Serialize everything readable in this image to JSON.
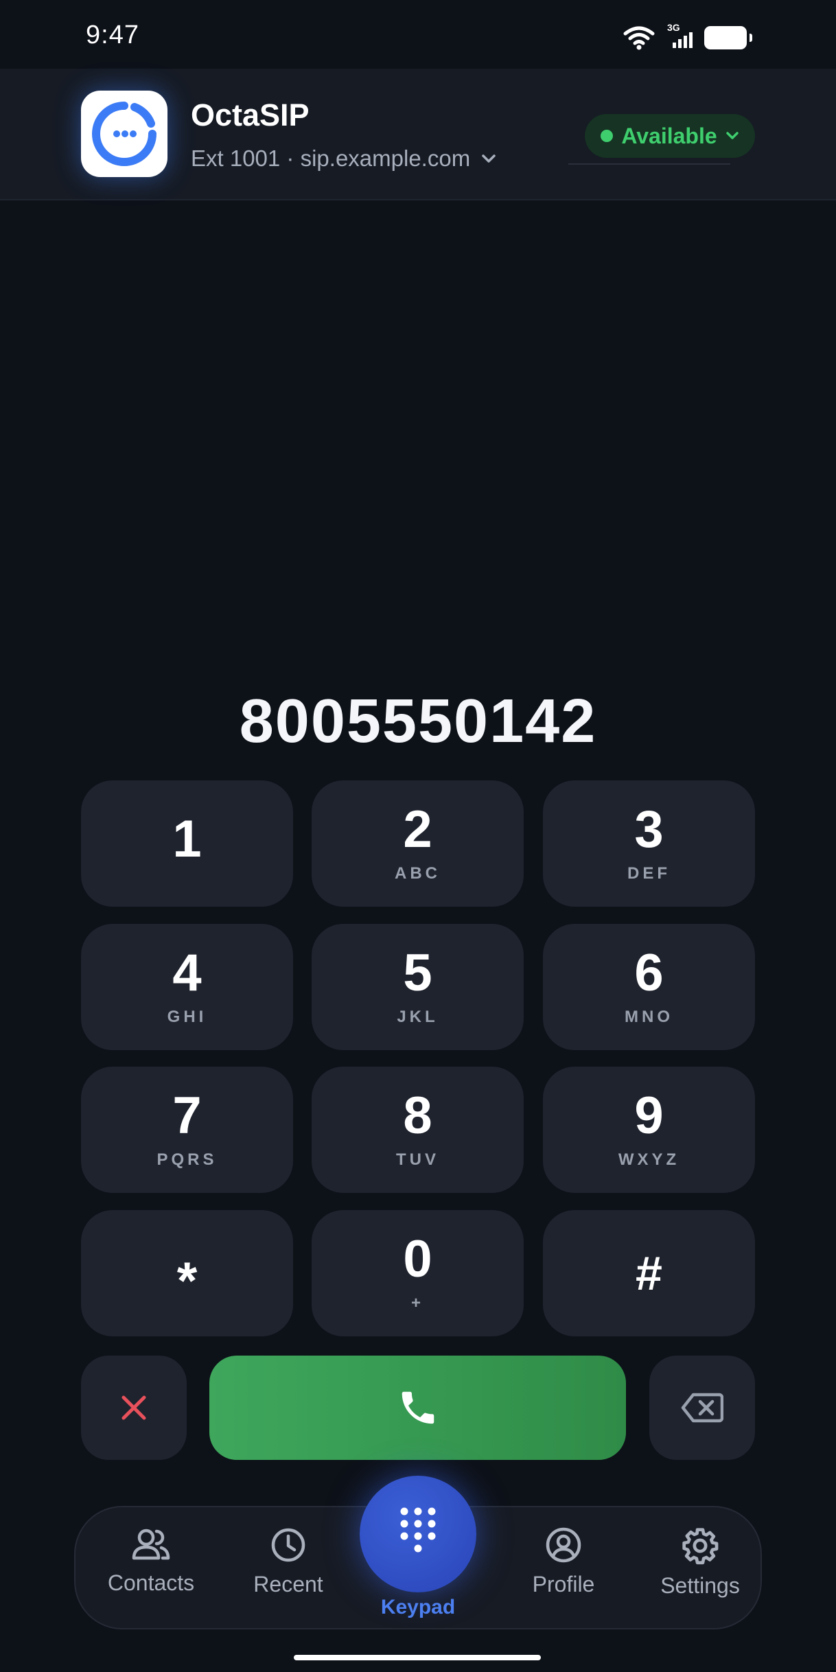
{
  "status_bar": {
    "time": "9:47",
    "network": "3G"
  },
  "header": {
    "app_name": "OctaSIP",
    "account": "Ext 1001 · sip.example.com",
    "presence": "Available",
    "presence_color": "#3fce6e",
    "logo_icon": "chat-bubble-logo-icon"
  },
  "dialer": {
    "number": "8005550142"
  },
  "keypad": {
    "keys": [
      {
        "digit": "1",
        "letters": ""
      },
      {
        "digit": "2",
        "letters": "ABC"
      },
      {
        "digit": "3",
        "letters": "DEF"
      },
      {
        "digit": "4",
        "letters": "GHI"
      },
      {
        "digit": "5",
        "letters": "JKL"
      },
      {
        "digit": "6",
        "letters": "MNO"
      },
      {
        "digit": "7",
        "letters": "PQRS"
      },
      {
        "digit": "8",
        "letters": "TUV"
      },
      {
        "digit": "9",
        "letters": "WXYZ"
      },
      {
        "digit": "*",
        "letters": ""
      },
      {
        "digit": "0",
        "letters": "+"
      },
      {
        "digit": "#",
        "letters": ""
      }
    ]
  },
  "actions": {
    "clear_icon": "close-icon",
    "call_icon": "phone-icon",
    "backspace_icon": "backspace-icon",
    "call_color": "#3ea75c",
    "clear_color": "#e8515b"
  },
  "nav": {
    "contacts": "Contacts",
    "recent": "Recent",
    "keypad": "Keypad",
    "profile": "Profile",
    "settings": "Settings",
    "active_color": "#4c7ff0"
  }
}
